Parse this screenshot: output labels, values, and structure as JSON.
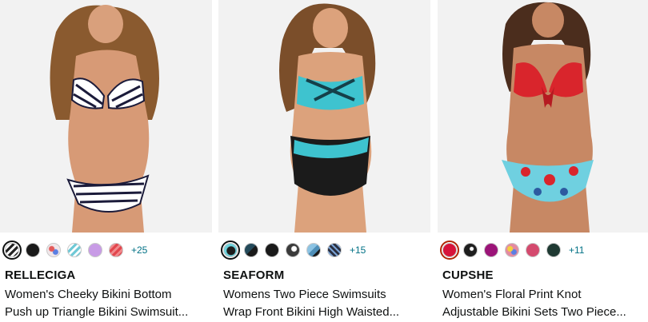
{
  "products": [
    {
      "brand": "RELLECIGA",
      "title_line1": "Women's Cheeky Bikini Bottom",
      "title_line2": "Push up Triangle Bikini Swimsuit...",
      "more_colors": "+25",
      "swatch_colors": [
        "#222222",
        "#1a1a1a",
        "#d9c2c8",
        "#6fc9d6",
        "#c89be6",
        "#e2464d"
      ]
    },
    {
      "brand": "SEAFORM",
      "title_line1": "Womens Two Piece Swimsuits",
      "title_line2": "Wrap Front Bikini High Waisted...",
      "more_colors": "+15",
      "swatch_colors": [
        "#1d1d1d",
        "#244a5a",
        "#1a1a1a",
        "#3b3b3b",
        "#4f8fb8",
        "#2a2f3f"
      ]
    },
    {
      "brand": "CUPSHE",
      "title_line1": "Women's Floral Print Knot",
      "title_line2": "Adjustable Bikini Sets Two Piece...",
      "more_colors": "+11",
      "swatch_colors": [
        "#d7143a",
        "#1e1e1e",
        "#9b1478",
        "#e58aa0",
        "#d44a6e",
        "#1f3a33"
      ]
    }
  ]
}
